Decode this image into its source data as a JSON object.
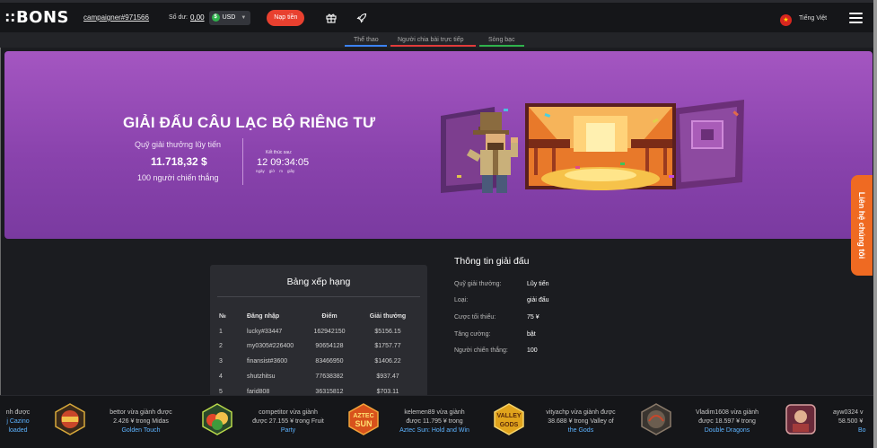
{
  "header": {
    "logo": "BONS",
    "logo_mark": "∷",
    "user": "campaigner#971566",
    "balance_label": "Số dư:",
    "balance_value": "0,00",
    "currency": "USD",
    "currency_symbol": "$",
    "deposit_label": "Nạp tiền",
    "language": "Tiếng Việt"
  },
  "nav": {
    "tabs": [
      {
        "label": "Thể thao",
        "color": "#3b82f6"
      },
      {
        "label": "Người chia bài trực tiếp",
        "color": "#e23b3b"
      },
      {
        "label": "Sòng bạc",
        "color": "#2fb24c"
      }
    ]
  },
  "banner": {
    "title": "GIẢI ĐẤU CÂU LẠC BỘ RIÊNG TƯ",
    "pool_label": "Quỹ giải thưởng lũy tiến",
    "pool_value": "11.718,32 $",
    "winners": "100 người chiến thắng",
    "ends_label": "Kết thúc sau:",
    "countdown": "12 09:34:05",
    "units": [
      "ngày",
      "giờ",
      "m",
      "giây"
    ]
  },
  "leaderboard": {
    "title": "Bảng xếp hạng",
    "columns": [
      "№",
      "Đăng nhập",
      "Điểm",
      "Giải thưởng"
    ],
    "rows": [
      [
        "1",
        "lucky#33447",
        "162942150",
        "$5156.15"
      ],
      [
        "2",
        "my0305#226400",
        "90654128",
        "$1757.77"
      ],
      [
        "3",
        "finansist#3600",
        "83466950",
        "$1406.22"
      ],
      [
        "4",
        "shutzhitsu",
        "77638382",
        "$937.47"
      ],
      [
        "5",
        "farid808",
        "36315812",
        "$703.11"
      ]
    ]
  },
  "info": {
    "title": "Thông tin giải đấu",
    "rows": [
      {
        "key": "Quỹ giải thưởng:",
        "value": "Lũy tiến"
      },
      {
        "key": "Loại:",
        "value": "giải đấu"
      },
      {
        "key": "Cược tối thiểu:",
        "value": "75 ¥"
      },
      {
        "key": "Tăng cường:",
        "value": "bật"
      },
      {
        "key": "Người chiến thắng:",
        "value": "100"
      }
    ]
  },
  "contact": {
    "label": "Liên hệ chúng tôi"
  },
  "ticker": [
    {
      "line1": "nh được",
      "line2": "j Cazino",
      "line3": "loaded"
    },
    {
      "line1": "bettor vừa giành được",
      "line2": "2.426 ¥ trong Midas",
      "line3": "Golden Touch"
    },
    {
      "line1": "competitor vừa giành",
      "line2": "được 27.155 ¥ trong Fruit",
      "line3": "Party"
    },
    {
      "line1": "kelemen89 vừa giành",
      "line2": "được 11.795 ¥ trong",
      "line3": "Aztec Sun: Hold and Win"
    },
    {
      "line1": "vityachp vừa giành được",
      "line2": "38.688 ¥ trong Valley of",
      "line3": "the Gods"
    },
    {
      "line1": "Vladim1608 vừa giành",
      "line2": "được 18.597 ¥ trong",
      "line3": "Double Dragons"
    },
    {
      "line1": "ayw0324 v",
      "line2": "58.500 ¥",
      "line3": "Bo"
    }
  ],
  "ticker_icons": [
    {
      "label": "",
      "color": "#c9462a"
    },
    {
      "label": "",
      "color": "#3f9a3c"
    },
    {
      "label": "AZTEC SUN",
      "color": "#d8521c"
    },
    {
      "label": "VALLEY GODS",
      "color": "#e0a31c"
    },
    {
      "label": "",
      "color": "#6b5d4f"
    },
    {
      "label": "",
      "color": "#a33b3b"
    }
  ]
}
